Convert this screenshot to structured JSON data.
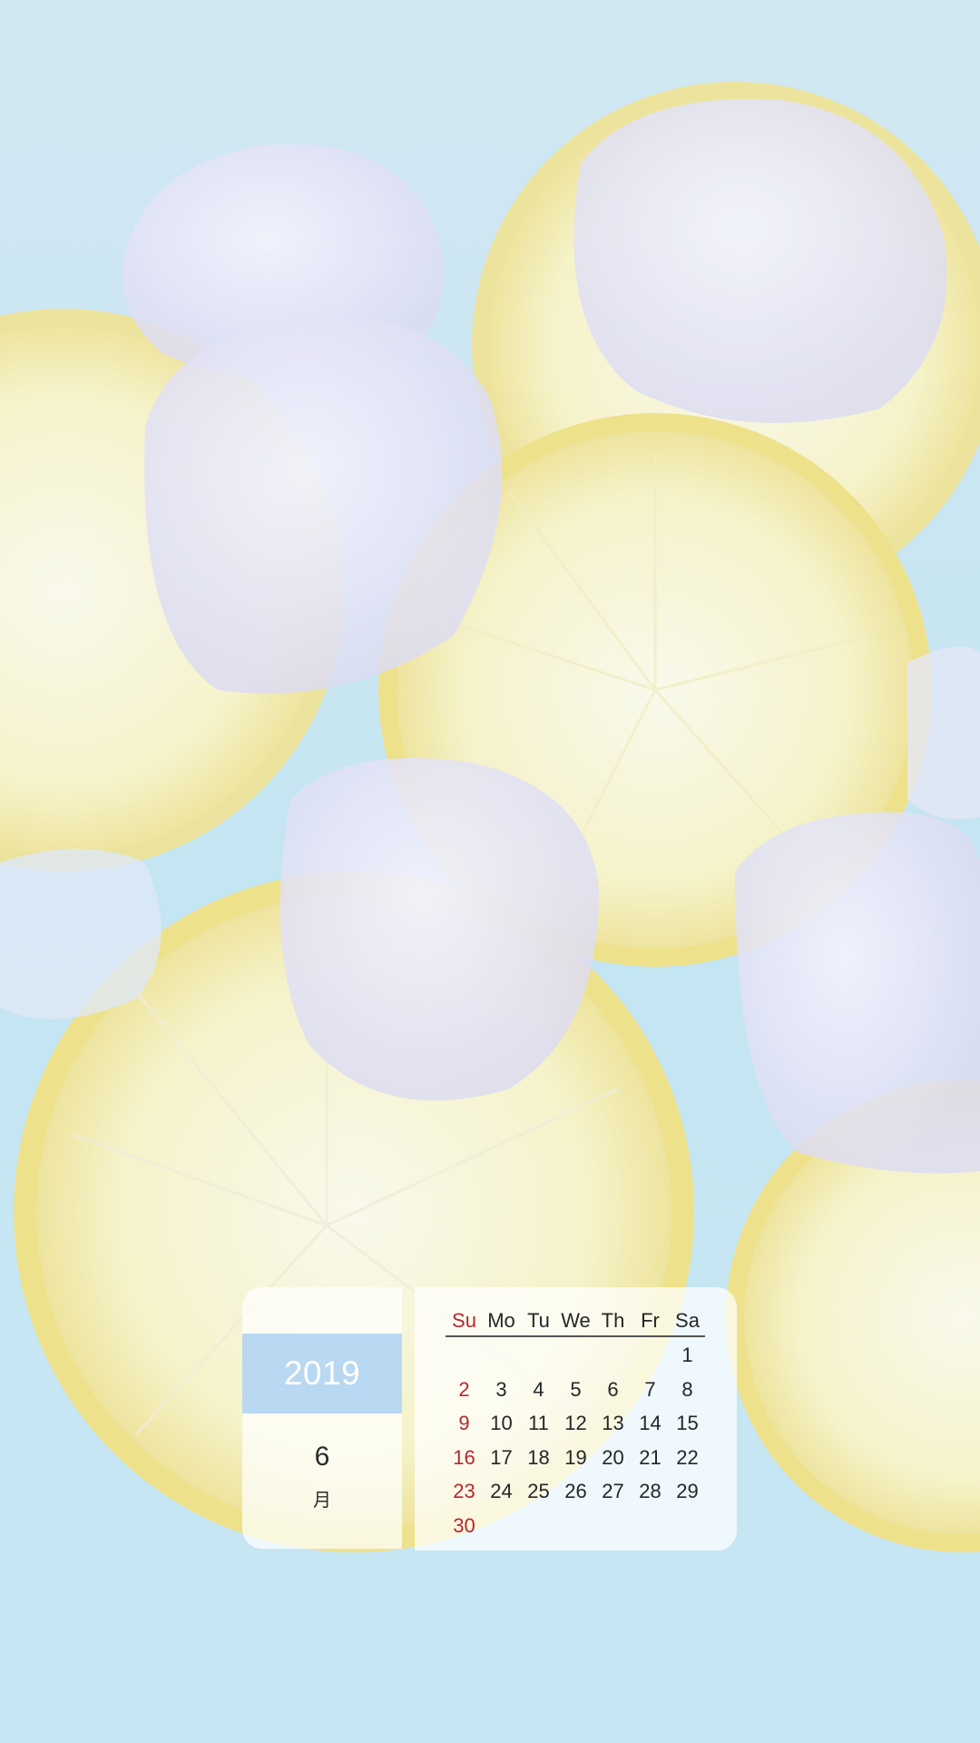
{
  "calendar": {
    "year": "2019",
    "month_number": "6",
    "month_char": "月",
    "weekdays": [
      "Su",
      "Mo",
      "Tu",
      "We",
      "Th",
      "Fr",
      "Sa"
    ],
    "weeks": [
      [
        "",
        "",
        "",
        "",
        "",
        "",
        "1"
      ],
      [
        "2",
        "3",
        "4",
        "5",
        "6",
        "7",
        "8"
      ],
      [
        "9",
        "10",
        "11",
        "12",
        "13",
        "14",
        "15"
      ],
      [
        "16",
        "17",
        "18",
        "19",
        "20",
        "21",
        "22"
      ],
      [
        "23",
        "24",
        "25",
        "26",
        "27",
        "28",
        "29"
      ],
      [
        "30",
        "",
        "",
        "",
        "",
        "",
        ""
      ]
    ],
    "colors": {
      "sunday": "#b8262c",
      "year_band": "#b9d8f1",
      "text": "#262626"
    }
  },
  "background": {
    "subject": "lemon slices and ice cubes in light blue water"
  }
}
